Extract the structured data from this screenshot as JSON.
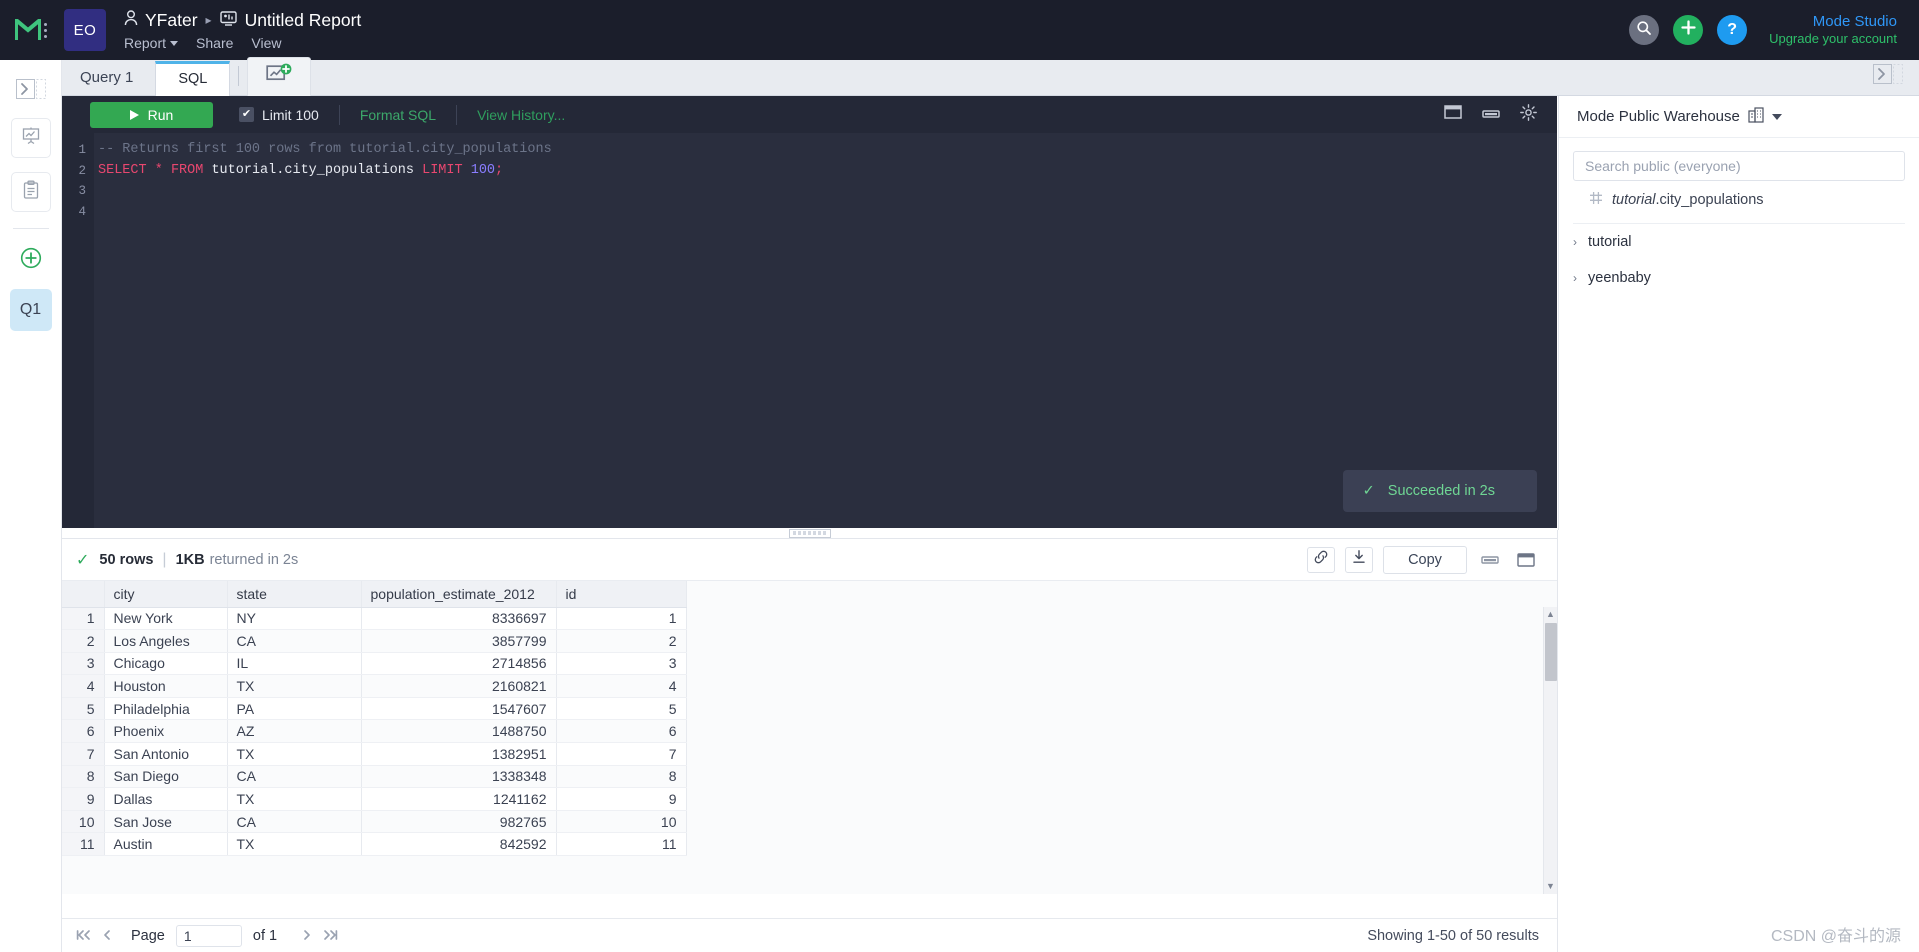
{
  "topbar": {
    "logo_name": "mode-logo",
    "avatar_initials": "EO",
    "breadcrumb": {
      "user": "YFater",
      "separator": "▸",
      "report": "Untitled Report"
    },
    "menu": [
      "Report",
      "Share",
      "View"
    ],
    "menu_report": "Report",
    "menu_share": "Share",
    "menu_view": "View",
    "help_glyph": "?",
    "studio_title": "Mode Studio",
    "studio_sub": "Upgrade your account"
  },
  "rail": {
    "expand_label": "›",
    "q1_label": "Q1"
  },
  "tabs": {
    "query_label": "Query 1",
    "sql_tab": "SQL",
    "chart_tab_icon": "add-chart-icon",
    "collapse_right": "›"
  },
  "editor": {
    "run_label": "Run",
    "limit_label": "Limit 100",
    "limit_checked": true,
    "check_glyph": "✔",
    "format_label": "Format SQL",
    "history_label": "View History...",
    "gutter": [
      "1",
      "2",
      "3",
      "4"
    ],
    "code": {
      "line1_comment": "-- Returns first 100 rows from tutorial.city_populations",
      "line2": {
        "select": "SELECT",
        "star": "*",
        "from": "FROM",
        "table": "tutorial.city_populations",
        "limit": "LIMIT",
        "number": "100",
        "semicolon": ";"
      }
    },
    "toast": {
      "check": "✓",
      "text": "Succeeded in 2s"
    }
  },
  "schema": {
    "title": "Mode Public Warehouse",
    "search_placeholder": "Search public (everyone)",
    "search_value": "",
    "result_schema": "tutorial",
    "result_table": ".city_populations",
    "nodes": [
      {
        "chevron": "›",
        "label": "tutorial"
      },
      {
        "chevron": "›",
        "label": "yeenbaby"
      }
    ]
  },
  "results": {
    "check": "✓",
    "rows_text": "50 rows",
    "pipe": "|",
    "size_text": "1KB",
    "returned_text": "returned in 2s",
    "copy_label": "Copy",
    "columns": [
      "",
      "city",
      "state",
      "population_estimate_2012",
      "id"
    ],
    "rows": [
      {
        "n": "1",
        "city": "New York",
        "state": "NY",
        "pop": "8336697",
        "id": "1"
      },
      {
        "n": "2",
        "city": "Los Angeles",
        "state": "CA",
        "pop": "3857799",
        "id": "2"
      },
      {
        "n": "3",
        "city": "Chicago",
        "state": "IL",
        "pop": "2714856",
        "id": "3"
      },
      {
        "n": "4",
        "city": "Houston",
        "state": "TX",
        "pop": "2160821",
        "id": "4"
      },
      {
        "n": "5",
        "city": "Philadelphia",
        "state": "PA",
        "pop": "1547607",
        "id": "5"
      },
      {
        "n": "6",
        "city": "Phoenix",
        "state": "AZ",
        "pop": "1488750",
        "id": "6"
      },
      {
        "n": "7",
        "city": "San Antonio",
        "state": "TX",
        "pop": "1382951",
        "id": "7"
      },
      {
        "n": "8",
        "city": "San Diego",
        "state": "CA",
        "pop": "1338348",
        "id": "8"
      },
      {
        "n": "9",
        "city": "Dallas",
        "state": "TX",
        "pop": "1241162",
        "id": "9"
      },
      {
        "n": "10",
        "city": "San Jose",
        "state": "CA",
        "pop": "982765",
        "id": "10"
      },
      {
        "n": "11",
        "city": "Austin",
        "state": "TX",
        "pop": "842592",
        "id": "11"
      }
    ]
  },
  "pager": {
    "first": "⏮",
    "prev": "◂",
    "page_label": "Page",
    "page_value": "1",
    "of_label": "of 1",
    "next": "▸",
    "last": "⏭",
    "showing": "Showing 1-50 of 50 results"
  },
  "watermark": "CSDN @奋斗的源"
}
